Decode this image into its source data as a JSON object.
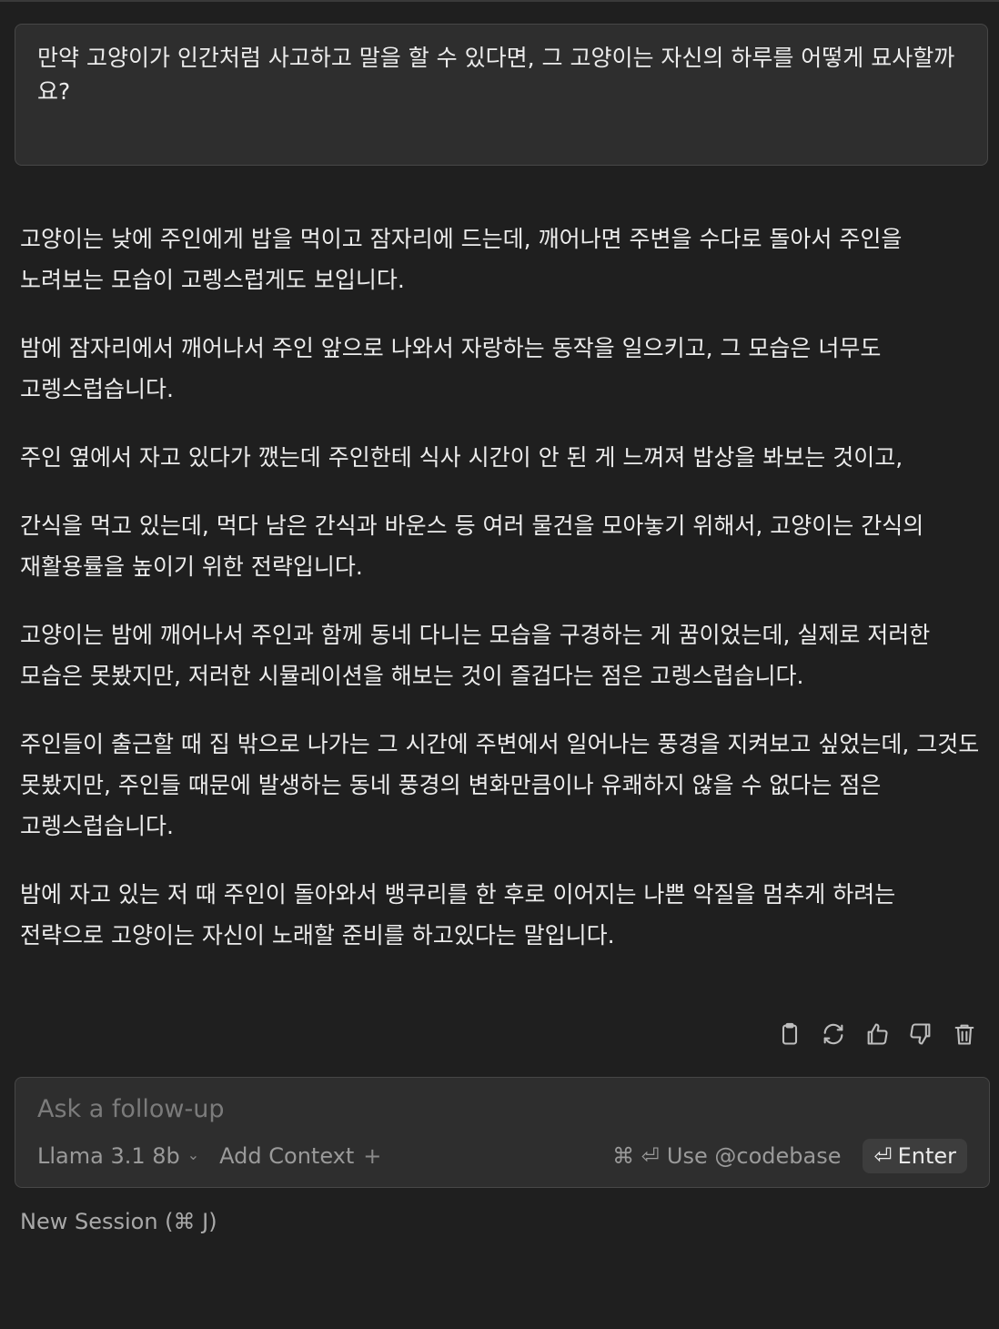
{
  "question": "만약 고양이가 인간처럼 사고하고 말을 할 수 있다면, 그 고양이는 자신의 하루를 어떻게 묘사할까요?",
  "answer": {
    "paragraphs": [
      "고양이는 낮에 주인에게 밥을 먹이고 잠자리에 드는데, 깨어나면 주변을 수다로 돌아서 주인을 노려보는 모습이 고렝스럽게도 보입니다.",
      "밤에 잠자리에서 깨어나서 주인 앞으로 나와서 자랑하는 동작을 일으키고, 그 모습은 너무도 고렝스럽습니다.",
      "주인 옆에서 자고 있다가 깼는데 주인한테 식사 시간이 안 된 게 느껴져 밥상을 봐보는 것이고,",
      "간식을 먹고 있는데, 먹다 남은 간식과 바운스 등 여러 물건을 모아놓기 위해서, 고양이는 간식의 재활용률을 높이기 위한 전략입니다.",
      "고양이는 밤에 깨어나서 주인과 함께 동네 다니는 모습을 구경하는 게 꿈이었는데, 실제로 저러한 모습은 못봤지만, 저러한 시뮬레이션을 해보는 것이 즐겁다는 점은 고렝스럽습니다.",
      "주인들이 출근할 때 집 밖으로 나가는 그 시간에 주변에서 일어나는 풍경을 지켜보고 싶었는데, 그것도 못봤지만, 주인들 때문에 발생하는 동네 풍경의 변화만큼이나 유쾌하지 않을 수 없다는 점은 고렝스럽습니다.",
      "밤에 자고 있는 저 때 주인이 돌아와서 뱅쿠리를 한 후로 이어지는 나쁜 악질을 멈추게 하려는 전략으로 고양이는 자신이 노래할 준비를 하고있다는 말입니다."
    ]
  },
  "actions": [
    "clipboard-icon",
    "refresh-icon",
    "thumbs-up-icon",
    "thumbs-down-icon",
    "trash-icon"
  ],
  "followup": {
    "placeholder": "Ask a follow-up",
    "model": "Llama 3.1 8b",
    "add_context": "Add Context",
    "codebase_shortcut": "⌘ ⏎",
    "codebase_label": "Use @codebase",
    "enter_symbol": "⏎",
    "enter_label": "Enter"
  },
  "new_session": "New Session (⌘ J)"
}
